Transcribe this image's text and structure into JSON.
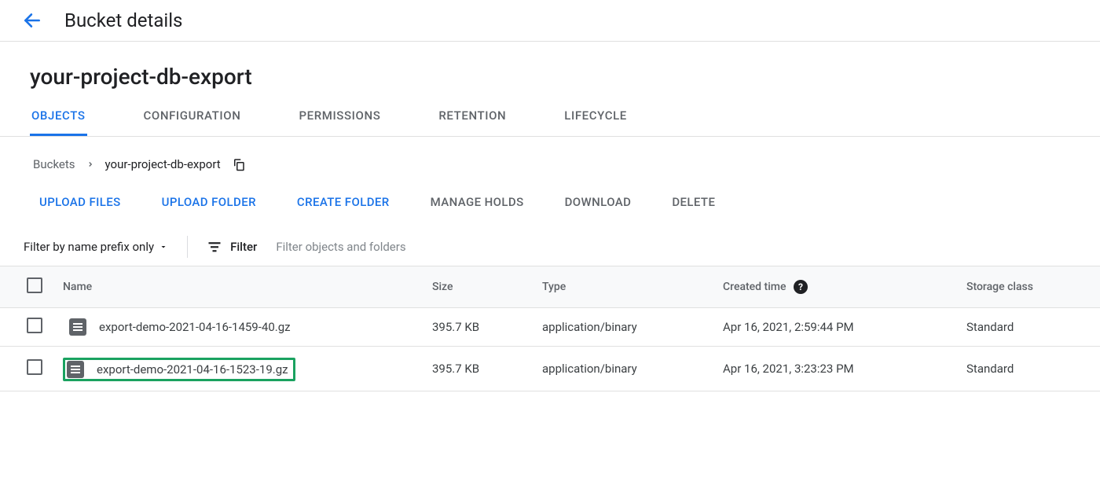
{
  "header": {
    "title": "Bucket details"
  },
  "bucket": {
    "name": "your-project-db-export"
  },
  "tabs": [
    {
      "label": "OBJECTS",
      "active": true
    },
    {
      "label": "CONFIGURATION",
      "active": false
    },
    {
      "label": "PERMISSIONS",
      "active": false
    },
    {
      "label": "RETENTION",
      "active": false
    },
    {
      "label": "LIFECYCLE",
      "active": false
    }
  ],
  "breadcrumb": {
    "root": "Buckets",
    "current": "your-project-db-export"
  },
  "actions": {
    "upload_files": "UPLOAD FILES",
    "upload_folder": "UPLOAD FOLDER",
    "create_folder": "CREATE FOLDER",
    "manage_holds": "MANAGE HOLDS",
    "download": "DOWNLOAD",
    "delete": "DELETE"
  },
  "filter": {
    "prefix_label": "Filter by name prefix only",
    "chip_label": "Filter",
    "placeholder": "Filter objects and folders"
  },
  "columns": {
    "name": "Name",
    "size": "Size",
    "type": "Type",
    "created": "Created time",
    "storage_class": "Storage class"
  },
  "rows": [
    {
      "name": "export-demo-2021-04-16-1459-40.gz",
      "size": "395.7 KB",
      "type": "application/binary",
      "created": "Apr 16, 2021, 2:59:44 PM",
      "storage_class": "Standard",
      "highlighted": false
    },
    {
      "name": "export-demo-2021-04-16-1523-19.gz",
      "size": "395.7 KB",
      "type": "application/binary",
      "created": "Apr 16, 2021, 3:23:23 PM",
      "storage_class": "Standard",
      "highlighted": true
    }
  ]
}
